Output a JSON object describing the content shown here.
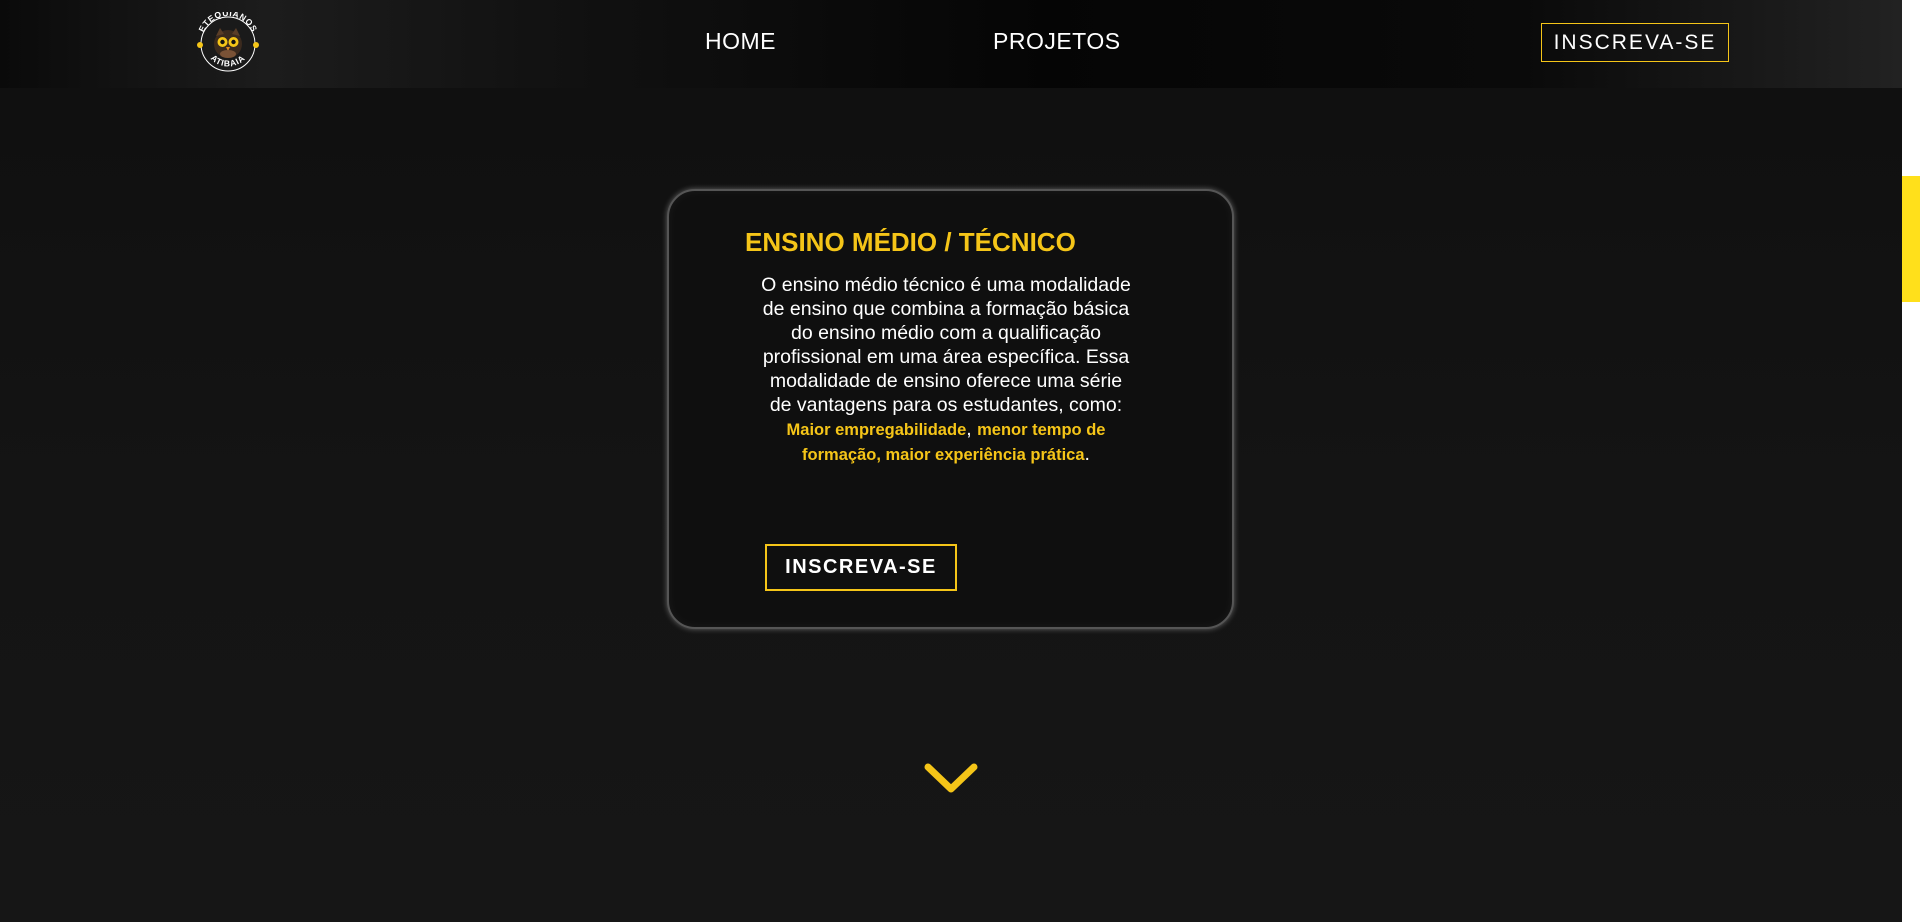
{
  "header": {
    "logo": {
      "text_top": "ETEQUIANOS",
      "text_bottom": "ATIBAIA",
      "icon": "owl-icon"
    },
    "nav": [
      {
        "label": "HOME"
      },
      {
        "label": "PROJETOS"
      }
    ],
    "subscribe_label": "INSCREVA-SE"
  },
  "card": {
    "title": "ENSINO MÉDIO / TÉCNICO",
    "text_intro": "O ensino médio técnico é uma modalidade de ensino que combina a formação básica do ensino médio com a qualificação profissional em uma área específica. Essa modalidade de ensino oferece uma série de vantagens para os estudantes, como: ",
    "highlight_1": "Maior empregabilidade",
    "sep_1": ", ",
    "highlight_2": "menor tempo de formação",
    "sep_2": ", ",
    "highlight_3": "maior experiência prática",
    "end": ".",
    "button_label": "INSCREVA-SE"
  },
  "scroll_indicator": {
    "icon": "chevron-down-icon"
  },
  "colors": {
    "accent": "#f5c518",
    "background": "#121212",
    "text": "#ffffff",
    "scrollbar_thumb": "#ffe01b"
  }
}
